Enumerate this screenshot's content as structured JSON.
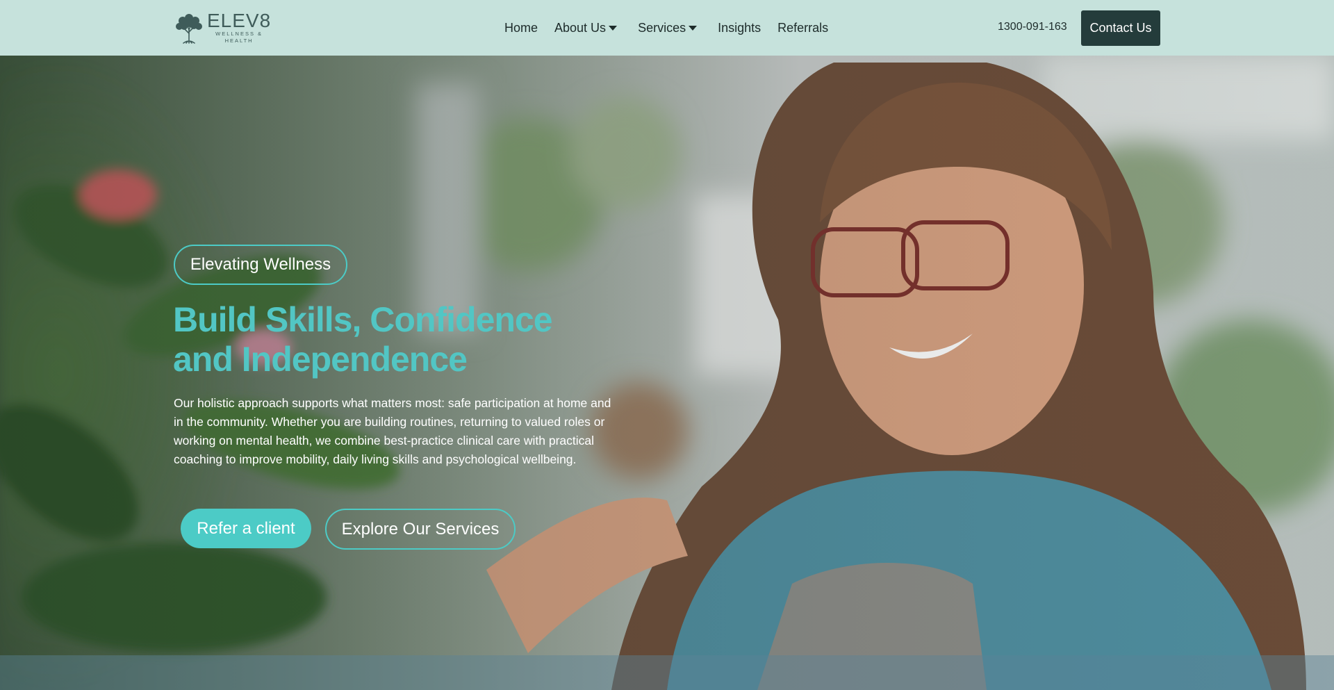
{
  "brand": {
    "name": "ELEV8",
    "tagline_line1": "WELLNESS &",
    "tagline_line2": "HEALTH",
    "logo_icon": "tree-icon",
    "color_dark": "#243c3b",
    "color_accent": "#4ccbc6",
    "color_header_bg": "#c6e2dc"
  },
  "nav": {
    "items": [
      {
        "label": "Home"
      },
      {
        "label": "About Us",
        "dropdown": true
      },
      {
        "label": "Services",
        "dropdown": true
      },
      {
        "label": "Insights"
      },
      {
        "label": "Referrals"
      }
    ]
  },
  "header": {
    "phone": "1300-091-163",
    "contact_label": "Contact Us"
  },
  "hero": {
    "eyebrow": "Elevating Wellness",
    "headline_line1": "Build Skills, Confidence",
    "headline_line2": "and Independence",
    "description": "Our holistic approach supports what matters most: safe participation at home and in the community. Whether you are building routines, returning to valued roles or working on mental health, we combine best-practice clinical care with practical coaching to improve mobility, daily living skills and psychological wellbeing.",
    "cta_primary": "Refer a client",
    "cta_secondary": "Explore Our Services"
  }
}
